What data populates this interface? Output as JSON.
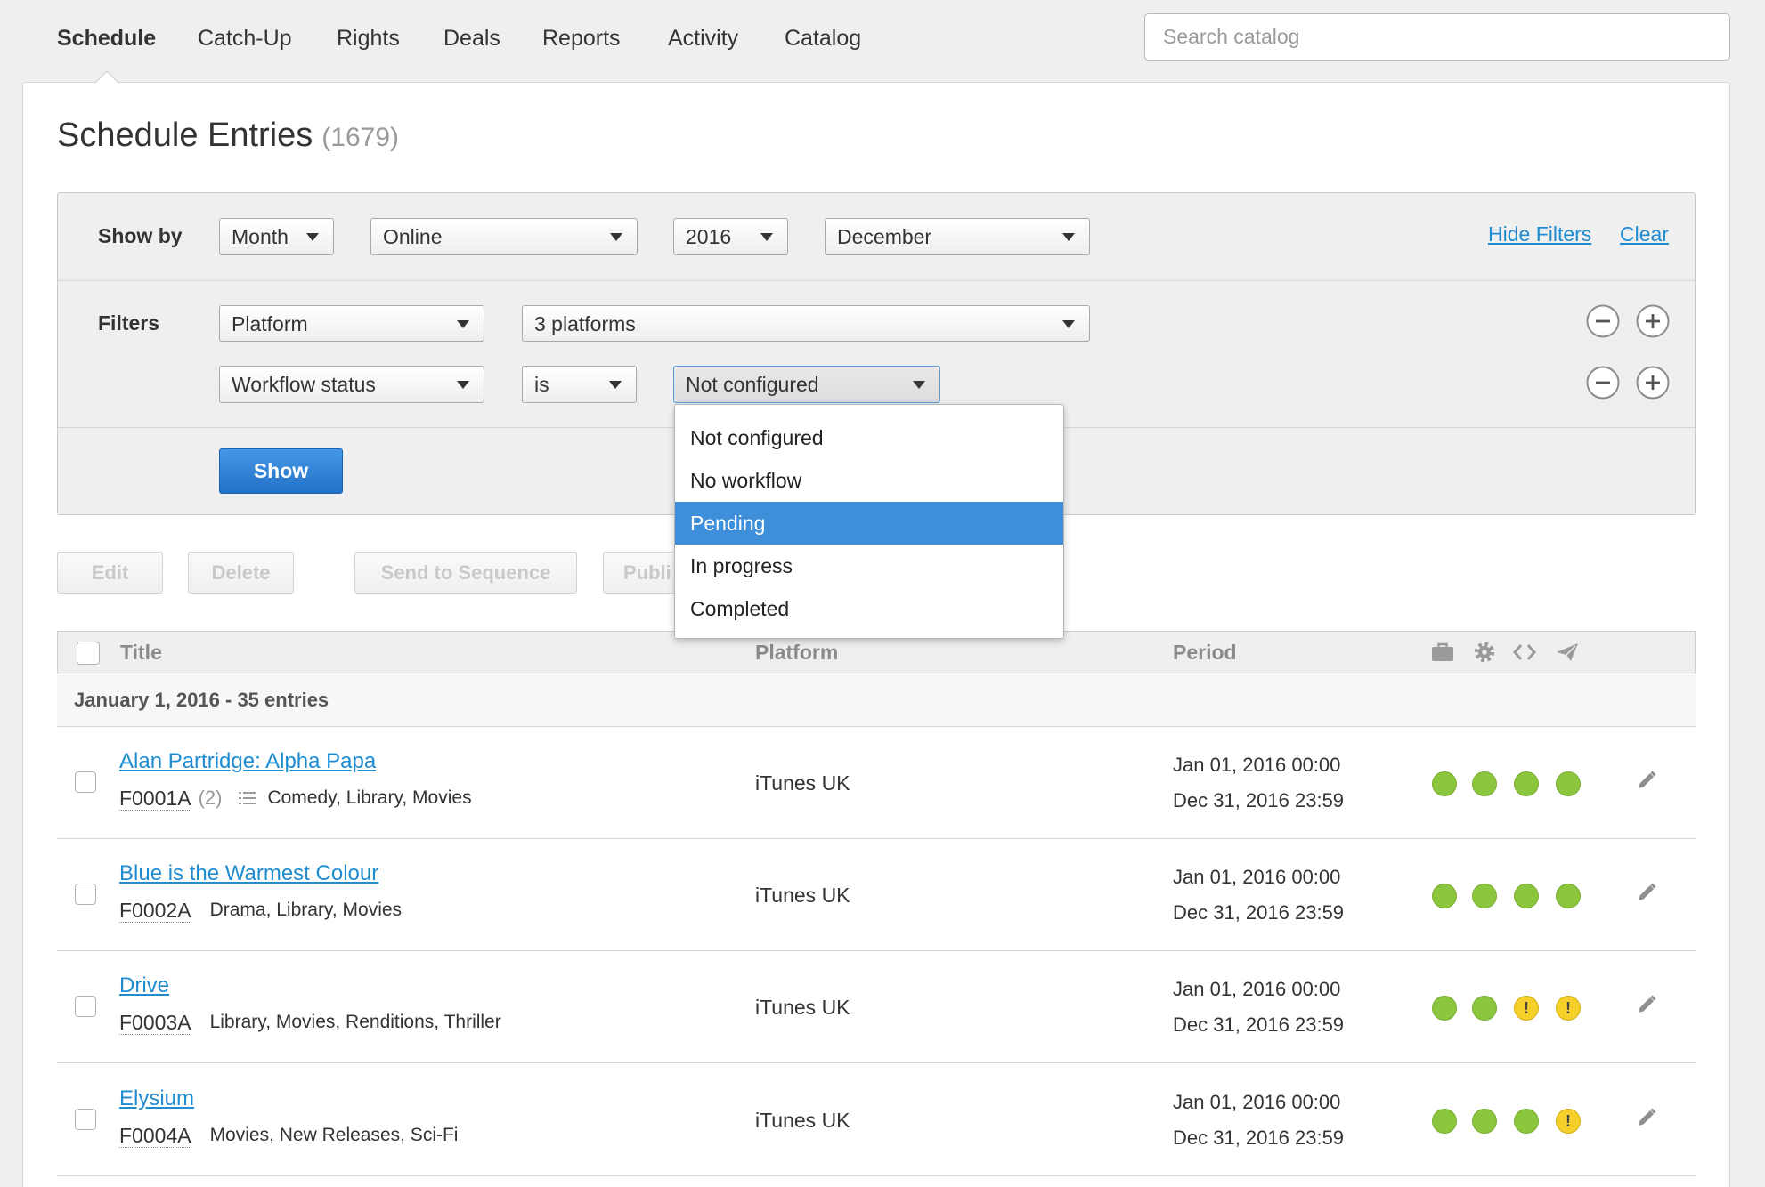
{
  "nav": {
    "items": [
      "Schedule",
      "Catch-Up",
      "Rights",
      "Deals",
      "Reports",
      "Activity",
      "Catalog"
    ],
    "active_index": 0
  },
  "search": {
    "placeholder": "Search catalog"
  },
  "page": {
    "title": "Schedule Entries",
    "count": "(1679)"
  },
  "filters": {
    "show_by": {
      "label": "Show by",
      "period": "Month",
      "channel": "Online",
      "year": "2016",
      "month": "December"
    },
    "links": {
      "hide_filters": "Hide Filters",
      "clear": "Clear"
    },
    "label": "Filters",
    "rows": [
      {
        "field": "Platform",
        "value": "3 platforms"
      },
      {
        "field": "Workflow status",
        "operator": "is",
        "value": "Not configured"
      }
    ],
    "show_button": "Show"
  },
  "workflow_dropdown": {
    "options": [
      "Not configured",
      "No workflow",
      "Pending",
      "In progress",
      "Completed"
    ],
    "highlighted_index": 2
  },
  "toolbar": {
    "edit": "Edit",
    "delete": "Delete",
    "send_to_sequence": "Send to Sequence",
    "publish": "Publi"
  },
  "table": {
    "columns": {
      "title": "Title",
      "platform": "Platform",
      "period": "Period"
    },
    "status_icons": [
      "briefcase-icon",
      "gear-icon",
      "code-icon",
      "send-icon"
    ],
    "group": "January 1, 2016 - 35 entries",
    "rows": [
      {
        "title": "Alan Partridge: Alpha Papa",
        "code": "F0001A",
        "versions": "(2)",
        "genres": "Comedy, Library, Movies",
        "platform": "iTunes UK",
        "start": "Jan 01, 2016 00:00",
        "end": "Dec 31, 2016 23:59",
        "status": [
          "green",
          "green",
          "green",
          "green"
        ]
      },
      {
        "title": "Blue is the Warmest Colour",
        "code": "F0002A",
        "genres": "Drama, Library, Movies",
        "platform": "iTunes UK",
        "start": "Jan 01, 2016 00:00",
        "end": "Dec 31, 2016 23:59",
        "status": [
          "green",
          "green",
          "green",
          "green"
        ]
      },
      {
        "title": "Drive",
        "code": "F0003A",
        "genres": "Library, Movies, Renditions, Thriller",
        "platform": "iTunes UK",
        "start": "Jan 01, 2016 00:00",
        "end": "Dec 31, 2016 23:59",
        "status": [
          "green",
          "green",
          "yellow",
          "yellow"
        ]
      },
      {
        "title": "Elysium",
        "code": "F0004A",
        "genres": "Movies, New Releases, Sci-Fi",
        "platform": "iTunes UK",
        "start": "Jan 01, 2016 00:00",
        "end": "Dec 31, 2016 23:59",
        "status": [
          "green",
          "green",
          "green",
          "yellow"
        ]
      }
    ]
  },
  "colors": {
    "link": "#1f8ccf",
    "primary_button": "#2f84d8",
    "highlight": "#3e8fda",
    "status_green": "#8cc63f",
    "status_yellow": "#f5d02a"
  }
}
